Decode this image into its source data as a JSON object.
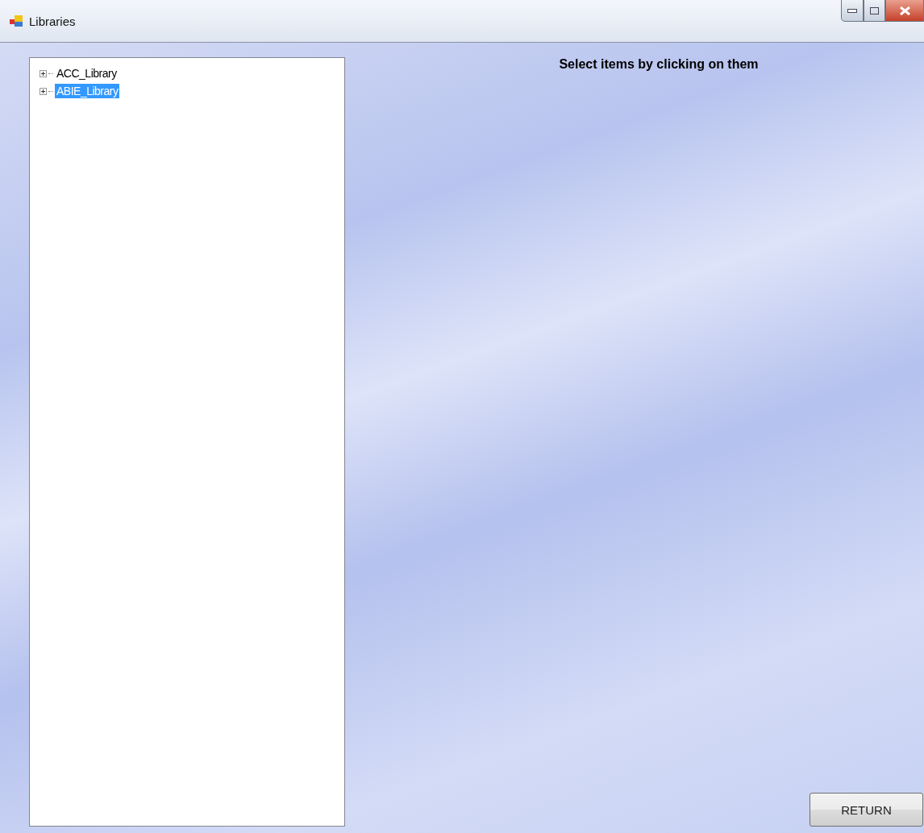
{
  "window": {
    "title": "Libraries"
  },
  "tree": {
    "items": [
      {
        "label": "ACC_Library",
        "expanded": false,
        "selected": false
      },
      {
        "label": "ABIE_Library",
        "expanded": false,
        "selected": true
      }
    ]
  },
  "heading": "Select items by clicking on them",
  "buttons": [
    "RETURN"
  ]
}
